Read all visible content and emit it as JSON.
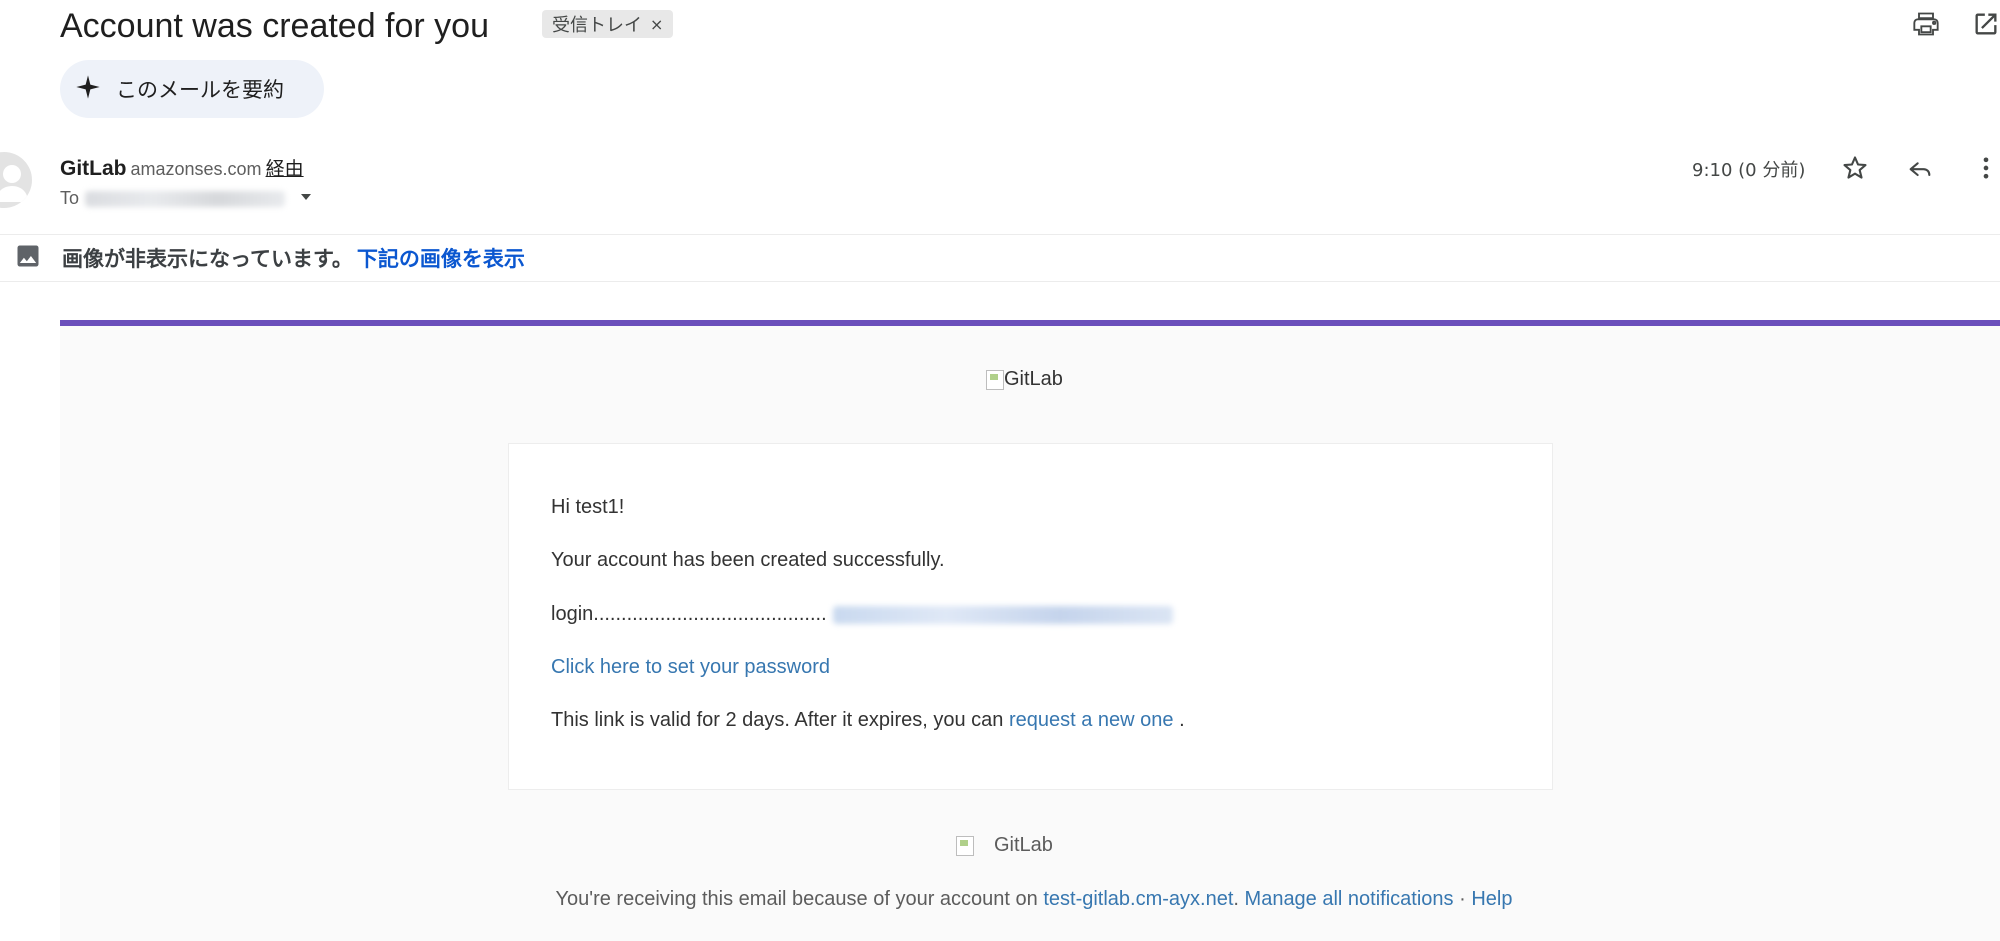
{
  "header": {
    "subject": "Account was created for you",
    "label_chip": "受信トレイ",
    "label_remove": "×",
    "summarize_label": "このメールを要約"
  },
  "sender": {
    "name": "GitLab",
    "domain": "amazonses.com",
    "via": "経由",
    "to_prefix": "To",
    "timestamp": "9:10 (0 分前)"
  },
  "image_notice": {
    "message": "画像が非表示になっています。",
    "link": "下記の画像を表示"
  },
  "email": {
    "logo_alt": "GitLab",
    "greeting": "Hi test1!",
    "created": "Your account has been created successfully.",
    "login_label": "login..........................................",
    "set_password_link": "Click here to set your password",
    "valid_prefix": "This link is valid for 2 days. After it expires, you can",
    "request_link": "request a new one",
    "valid_suffix": ".",
    "footer_logo_alt": "GitLab",
    "footer_prefix": "You're receiving this email because of your account on",
    "footer_domain": "test-gitlab.cm-ayx.net",
    "footer_period": ".",
    "footer_manage": "Manage all notifications",
    "footer_sep": "·",
    "footer_help": "Help"
  },
  "colors": {
    "gitlab_purple": "#6b4fbb",
    "gitlab_link": "#3777b0",
    "gmail_link": "#0b57d0"
  },
  "icons": {
    "summarize": "sparkle-icon",
    "print": "print-icon",
    "open_new_window": "open-in-new-icon",
    "star": "star-icon",
    "reply": "reply-icon",
    "more": "more-vert-icon",
    "image": "image-icon",
    "dropdown": "caret-down-icon"
  }
}
